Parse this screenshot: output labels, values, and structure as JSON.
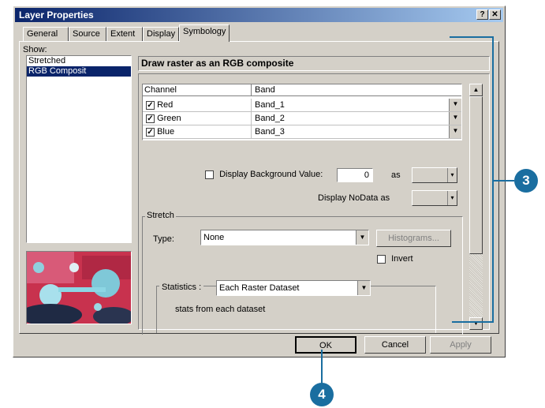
{
  "window": {
    "title": "Layer Properties",
    "help_btn": "?",
    "close_btn": "✕"
  },
  "tabs": [
    "General",
    "Source",
    "Extent",
    "Display",
    "Symbology"
  ],
  "show": {
    "label": "Show:",
    "items": [
      "Stretched",
      "RGB Composit"
    ]
  },
  "header": "Draw raster as an RGB composite",
  "table": {
    "headers": [
      "Channel",
      "Band"
    ],
    "rows": [
      {
        "channel": "Red",
        "band": "Band_1"
      },
      {
        "channel": "Green",
        "band": "Band_2"
      },
      {
        "channel": "Blue",
        "band": "Band_3"
      }
    ]
  },
  "background": {
    "label": "Display Background Value:",
    "value": "0",
    "as": "as"
  },
  "nodata": {
    "label": "Display NoData as"
  },
  "stretch": {
    "group": "Stretch",
    "type_label": "Type:",
    "type_value": "None",
    "histograms": "Histograms...",
    "invert": "Invert"
  },
  "statistics": {
    "label": "Statistics :",
    "value": "Each Raster Dataset",
    "note": "stats from each dataset"
  },
  "buttons": {
    "ok": "OK",
    "cancel": "Cancel",
    "apply": "Apply"
  },
  "callouts": {
    "three": "3",
    "four": "4"
  },
  "colors": {
    "accent": "#1a6ea0",
    "selection": "#0a246a"
  }
}
